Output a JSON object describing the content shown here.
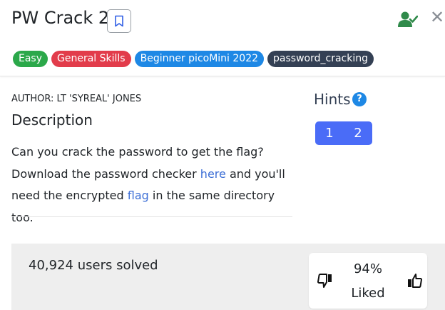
{
  "challenge": {
    "title": "PW Crack 2",
    "tags": [
      "Easy",
      "General Skills",
      "Beginner picoMini 2022",
      "password_cracking"
    ]
  },
  "icons": {
    "bookmark": "bookmark-icon",
    "solved_user": "user-check-icon",
    "close": "close-icon",
    "help": "question-circle-icon",
    "thumb_down": "thumbs-down-icon",
    "thumb_up": "thumbs-up-icon"
  },
  "colors": {
    "easy": "#2ba84a",
    "general_skills": "#e23c4b",
    "event": "#1e88e5",
    "topic": "#344054",
    "hint_buttons": "#4a6cf7",
    "link": "#3d6fd6",
    "solved_icon": "#2f8a4a"
  },
  "author": "AUTHOR: LT 'SYREAL' JONES",
  "description": {
    "heading": "Description",
    "text1": "Can you crack the password to get the flag? Download the password checker ",
    "link1": "here",
    "text2": " and you'll need the encrypted ",
    "link2": "flag",
    "text3": " in the same directory too."
  },
  "hints": {
    "heading": "Hints",
    "help_symbol": "?",
    "items": [
      "1",
      "2"
    ]
  },
  "stats": {
    "solved": "40,924 users solved",
    "liked_percent": "94%",
    "liked_label": "Liked"
  },
  "close_symbol": "✕"
}
